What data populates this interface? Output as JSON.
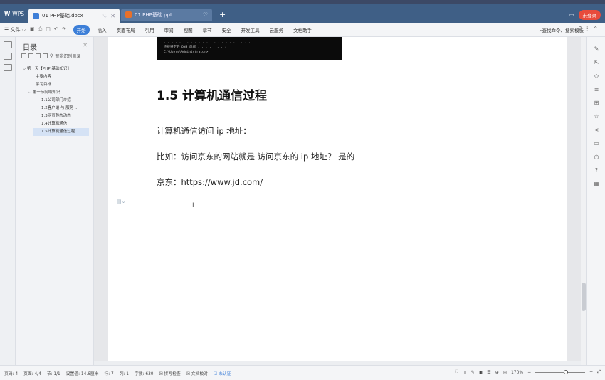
{
  "titlebar": {
    "app_label": "WPS",
    "tabs": [
      {
        "label": "01 PHP基础.docx",
        "icon_color": "#3d7fd8"
      },
      {
        "label": "01 PHP基础.ppt",
        "icon_color": "#e8702a"
      }
    ],
    "new_tab": "+",
    "login_label": "未登录"
  },
  "toolbar": {
    "file_label": "文件",
    "menu": [
      "开始",
      "插入",
      "页面布局",
      "引用",
      "审阅",
      "视图",
      "章节",
      "安全",
      "开发工具",
      "云服务",
      "文档助手"
    ],
    "search_label": "查找命令、搜索模板"
  },
  "outline": {
    "title": "目录",
    "smart_label": "智能识别目录",
    "items": [
      "第一天【PHP 基础知识】",
      "主要内容",
      "学习目标",
      "第一节网络知识",
      "1.1公司部门介绍",
      "1.2客户端 与 服务 ...",
      "1.3网页静态动态",
      "1.4计算机通信",
      "1.5计算机通信过程"
    ]
  },
  "document": {
    "cmd_lines": [
      "连接特定的 DNS 后缀 . . . . . . . :",
      "C:\\Users\\Administrator>_"
    ],
    "heading": "1.5 计算机通信过程",
    "paragraphs": [
      "计算机通信访问 ip 地址：",
      "比如：访问京东的网站就是  访问京东的 ip 地址？   是的",
      "京东：https://www.jd.com/"
    ]
  },
  "statusbar": {
    "items": [
      "页码: 4",
      "页面: 4/4",
      "节: 1/1",
      "设置值: 14.6厘米",
      "行: 7",
      "列: 1",
      "字数: 630",
      "拼写检查",
      "文档校对"
    ],
    "cert": "未认证",
    "zoom": "170%"
  }
}
